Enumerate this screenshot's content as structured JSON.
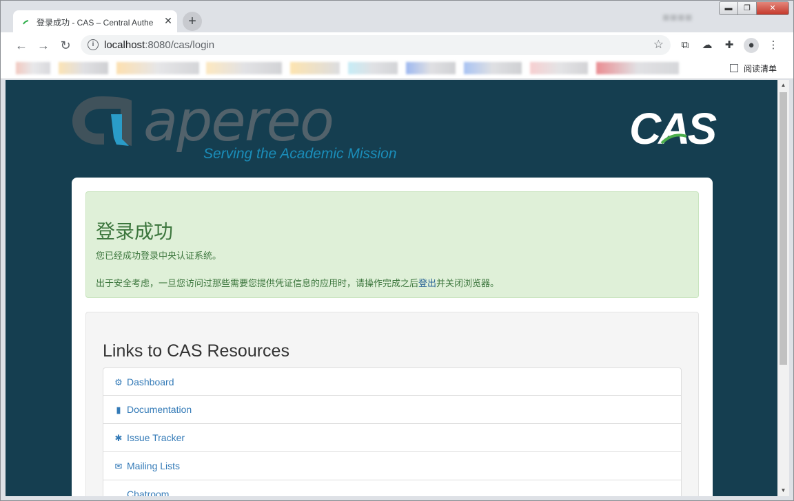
{
  "browser": {
    "tab_title": "登录成功 - CAS – Central Authe",
    "tab_close": "✕",
    "new_tab": "+",
    "url_host": "localhost",
    "url_path": ":8080/cas/login",
    "reading_list": "阅读清单",
    "window_min": "▬",
    "window_max": "❐",
    "window_close": "✕"
  },
  "header": {
    "apereo_word": "apereo",
    "apereo_tagline": "Serving the Academic Mission",
    "cas_logo": "CAS"
  },
  "success": {
    "heading": "登录成功",
    "line1": "您已经成功登录中央认证系统。",
    "line2_before": "出于安全考虑，一旦您访问过那些需要您提供凭证信息的应用时，请操作完成之后",
    "line2_link": "登出",
    "line2_after": "并关闭浏览器。"
  },
  "resources": {
    "heading": "Links to CAS Resources",
    "items": [
      {
        "label": "Dashboard",
        "icon": "cogs-icon",
        "glyph": "⚙"
      },
      {
        "label": "Documentation",
        "icon": "file-icon",
        "glyph": "▮"
      },
      {
        "label": "Issue Tracker",
        "icon": "bug-icon",
        "glyph": "✱"
      },
      {
        "label": "Mailing Lists",
        "icon": "envelope-icon",
        "glyph": "✉"
      },
      {
        "label": "Chatroom",
        "icon": "comment-icon",
        "glyph": "…"
      }
    ]
  },
  "colors": {
    "page_bg": "#153e50",
    "success_bg": "#dff0d8",
    "success_text": "#3c763d",
    "link": "#337ab7"
  }
}
